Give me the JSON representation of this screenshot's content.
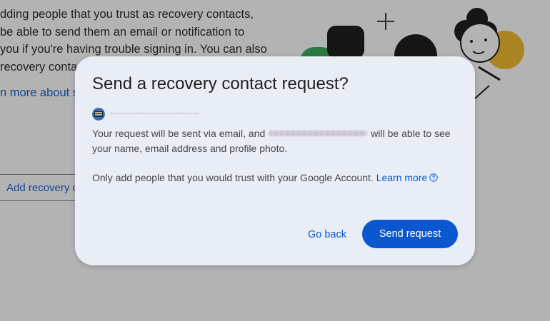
{
  "background": {
    "paragraph_lines": [
      "dding people that you trust as recovery contacts,",
      "be able to send them an email or notification to",
      "you if you're having trouble signing in. You can also",
      "recovery conta"
    ],
    "learn_more_partial": "n more about s",
    "add_button_label": "Add recovery c"
  },
  "dialog": {
    "title": "Send a recovery contact request?",
    "body_before": "Your request will be sent via email, and",
    "body_after": "will be able to see your name, email address and profile photo.",
    "trust_text": "Only add people that you would trust with your Google Account.",
    "learn_more": "Learn more",
    "go_back_label": "Go back",
    "send_label": "Send request"
  },
  "icons": {
    "help": "help-circle-icon",
    "plus": "plus-icon"
  },
  "colors": {
    "accent": "#0b57d0",
    "dialog_bg": "#e9eef6",
    "text": "#1f1f1f",
    "body": "#444746"
  }
}
